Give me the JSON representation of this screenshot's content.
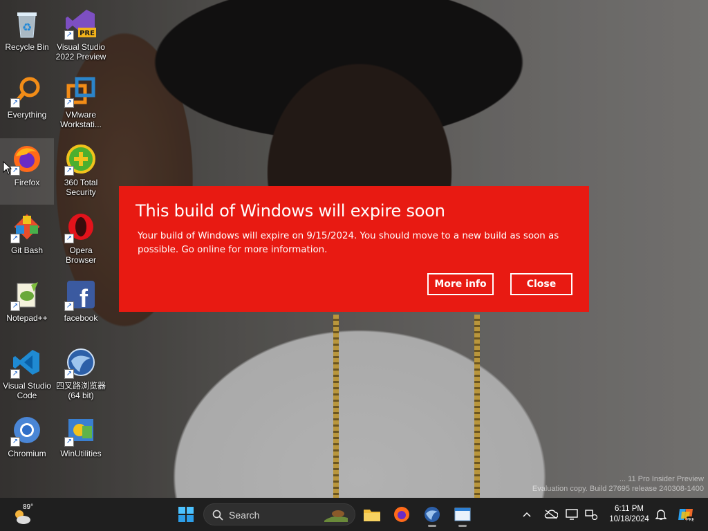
{
  "desktop": {
    "icons": [
      {
        "label": "Recycle Bin"
      },
      {
        "label": "Visual Studio 2022 Preview",
        "badge": "PRE"
      },
      {
        "label": "Everything"
      },
      {
        "label": "VMware Workstati..."
      },
      {
        "label": "Firefox"
      },
      {
        "label": "360 Total Security"
      },
      {
        "label": "Git Bash"
      },
      {
        "label": "Opera Browser"
      },
      {
        "label": "Notepad++"
      },
      {
        "label": "facebook"
      },
      {
        "label": "Visual Studio Code"
      },
      {
        "label": "四叉路浏览器 (64 bit)"
      },
      {
        "label": "Chromium"
      },
      {
        "label": "WinUtilities"
      }
    ],
    "watermark_line1": "... 11 Pro Insider Preview",
    "watermark_line2": "Evaluation copy. Build 27695 release 240308-1400"
  },
  "dialog": {
    "title": "This build of Windows will expire soon",
    "body": "Your build of Windows will expire on 9/15/2024. You should move to a new build as soon as possible. Go online for more information.",
    "more_info_label": "More info",
    "close_label": "Close",
    "background_color": "#e81a12"
  },
  "taskbar": {
    "weather_temp": "89°",
    "search_placeholder": "Search",
    "time": "6:11 PM",
    "date": "10/18/2024",
    "apps": [
      "start-icon",
      "file-explorer-icon",
      "firefox-icon",
      "browser-globe-icon",
      "window-app-icon"
    ],
    "tray": [
      "chevron-up-icon",
      "cloud-offline-icon",
      "display-icon",
      "network-icon",
      "notification-bell-icon",
      "copilot-icon"
    ]
  }
}
